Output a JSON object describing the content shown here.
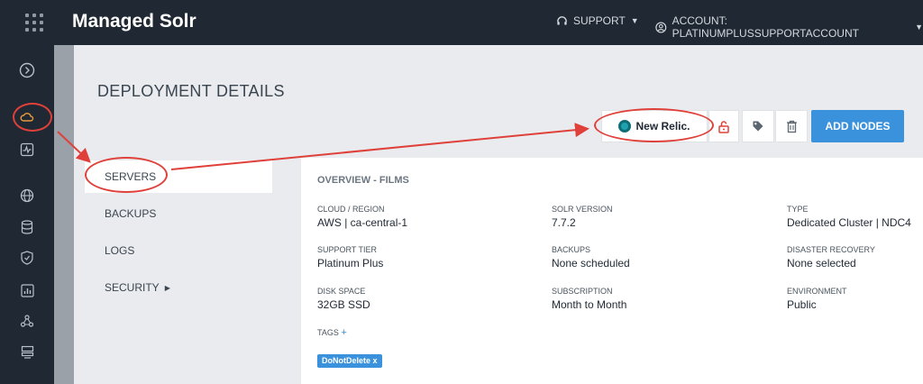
{
  "header": {
    "title": "Managed Solr",
    "support_label": "SUPPORT",
    "account_label": "ACCOUNT: PLATINUMPLUSSUPPORTACCOUNT"
  },
  "rail": {
    "icons": [
      "expand-icon",
      "cloud-icon",
      "activity-icon",
      "globe-icon",
      "database-icon",
      "shield-icon",
      "chart-icon",
      "network-icon",
      "server-icon"
    ]
  },
  "page": {
    "title": "DEPLOYMENT DETAILS"
  },
  "toolbar": {
    "new_relic_label": "New Relic.",
    "add_nodes_label": "ADD NODES"
  },
  "nav": {
    "items": [
      {
        "label": "SERVERS"
      },
      {
        "label": "BACKUPS"
      },
      {
        "label": "LOGS"
      },
      {
        "label": "SECURITY"
      }
    ]
  },
  "overview": {
    "title": "OVERVIEW - FILMS",
    "fields": [
      {
        "label": "CLOUD / REGION",
        "value": "AWS | ca-central-1"
      },
      {
        "label": "SOLR VERSION",
        "value": "7.7.2"
      },
      {
        "label": "TYPE",
        "value": "Dedicated Cluster | NDC4"
      },
      {
        "label": "SUPPORT TIER",
        "value": "Platinum Plus"
      },
      {
        "label": "BACKUPS",
        "value": "None scheduled"
      },
      {
        "label": "DISASTER RECOVERY",
        "value": "None selected"
      },
      {
        "label": "DISK SPACE",
        "value": "32GB SSD"
      },
      {
        "label": "SUBSCRIPTION",
        "value": "Month to Month"
      },
      {
        "label": "ENVIRONMENT",
        "value": "Public"
      }
    ],
    "tags_label": "TAGS",
    "tags_add": "+",
    "tags": [
      "DoNotDelete x"
    ]
  },
  "colors": {
    "accent": "#3a91dc",
    "annotation": "#e0403a",
    "topbar": "#1f2833"
  }
}
